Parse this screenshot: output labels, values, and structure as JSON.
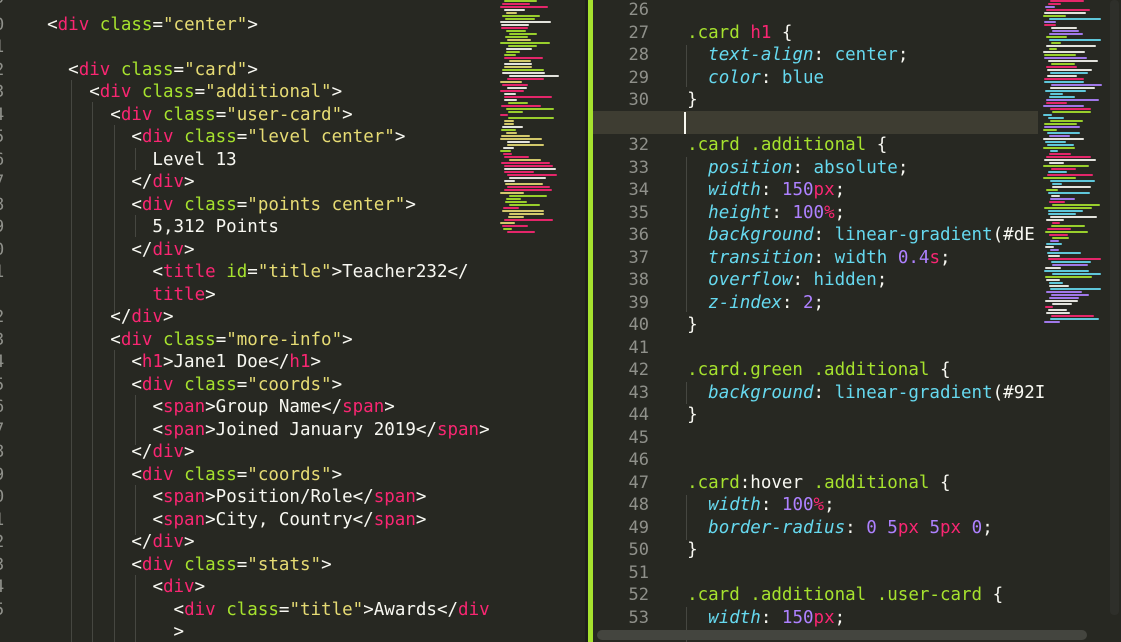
{
  "left_editor": {
    "line_numbers": [
      "0",
      "0",
      "1",
      "2",
      "3",
      "4",
      "5",
      "6",
      "7",
      "8",
      "9",
      "0",
      "1",
      "",
      "2",
      "3",
      "4",
      "5",
      "6",
      "7",
      "8",
      "9",
      "0",
      "1",
      "2",
      "3",
      "4",
      "5",
      ""
    ],
    "lines": [
      [
        [
          "p",
          "  "
        ],
        [
          "p",
          "<"
        ],
        [
          "t",
          "div"
        ],
        [
          "p",
          " "
        ],
        [
          "a",
          "class"
        ],
        [
          "p",
          "="
        ],
        [
          "s",
          "\"center\""
        ],
        [
          "p",
          ">"
        ]
      ],
      [],
      [
        [
          "p",
          "    "
        ],
        [
          "p",
          "<"
        ],
        [
          "t",
          "div"
        ],
        [
          "p",
          " "
        ],
        [
          "a",
          "class"
        ],
        [
          "p",
          "="
        ],
        [
          "s",
          "\"card\""
        ],
        [
          "p",
          ">"
        ]
      ],
      [
        [
          "p",
          "      "
        ],
        [
          "p",
          "<"
        ],
        [
          "t",
          "div"
        ],
        [
          "p",
          " "
        ],
        [
          "a",
          "class"
        ],
        [
          "p",
          "="
        ],
        [
          "s",
          "\"additional\""
        ],
        [
          "p",
          ">"
        ]
      ],
      [
        [
          "p",
          "        "
        ],
        [
          "p",
          "<"
        ],
        [
          "t",
          "div"
        ],
        [
          "p",
          " "
        ],
        [
          "a",
          "class"
        ],
        [
          "p",
          "="
        ],
        [
          "s",
          "\"user-card\""
        ],
        [
          "p",
          ">"
        ]
      ],
      [
        [
          "p",
          "          "
        ],
        [
          "p",
          "<"
        ],
        [
          "t",
          "div"
        ],
        [
          "p",
          " "
        ],
        [
          "a",
          "class"
        ],
        [
          "p",
          "="
        ],
        [
          "s",
          "\"level center\""
        ],
        [
          "p",
          ">"
        ]
      ],
      [
        [
          "p",
          "            Level 13"
        ]
      ],
      [
        [
          "p",
          "          "
        ],
        [
          "p",
          "</"
        ],
        [
          "t",
          "div"
        ],
        [
          "p",
          ">"
        ]
      ],
      [
        [
          "p",
          "          "
        ],
        [
          "p",
          "<"
        ],
        [
          "t",
          "div"
        ],
        [
          "p",
          " "
        ],
        [
          "a",
          "class"
        ],
        [
          "p",
          "="
        ],
        [
          "s",
          "\"points center\""
        ],
        [
          "p",
          ">"
        ]
      ],
      [
        [
          "p",
          "            5,312 Points"
        ]
      ],
      [
        [
          "p",
          "          "
        ],
        [
          "p",
          "</"
        ],
        [
          "t",
          "div"
        ],
        [
          "p",
          ">"
        ]
      ],
      [
        [
          "p",
          "            "
        ],
        [
          "p",
          "<"
        ],
        [
          "t",
          "title"
        ],
        [
          "p",
          " "
        ],
        [
          "a",
          "id"
        ],
        [
          "p",
          "="
        ],
        [
          "s",
          "\"title\""
        ],
        [
          "p",
          ">Teacher232</"
        ]
      ],
      [
        [
          "p",
          "            "
        ],
        [
          "t",
          "title"
        ],
        [
          "p",
          ">"
        ]
      ],
      [
        [
          "p",
          "        "
        ],
        [
          "p",
          "</"
        ],
        [
          "t",
          "div"
        ],
        [
          "p",
          ">"
        ]
      ],
      [
        [
          "p",
          "        "
        ],
        [
          "p",
          "<"
        ],
        [
          "t",
          "div"
        ],
        [
          "p",
          " "
        ],
        [
          "a",
          "class"
        ],
        [
          "p",
          "="
        ],
        [
          "s",
          "\"more-info\""
        ],
        [
          "p",
          ">"
        ]
      ],
      [
        [
          "p",
          "          "
        ],
        [
          "p",
          "<"
        ],
        [
          "t",
          "h1"
        ],
        [
          "p",
          ">Jane1 Doe</"
        ],
        [
          "t",
          "h1"
        ],
        [
          "p",
          ">"
        ]
      ],
      [
        [
          "p",
          "          "
        ],
        [
          "p",
          "<"
        ],
        [
          "t",
          "div"
        ],
        [
          "p",
          " "
        ],
        [
          "a",
          "class"
        ],
        [
          "p",
          "="
        ],
        [
          "s",
          "\"coords\""
        ],
        [
          "p",
          ">"
        ]
      ],
      [
        [
          "p",
          "            "
        ],
        [
          "p",
          "<"
        ],
        [
          "t",
          "span"
        ],
        [
          "p",
          ">Group Name</"
        ],
        [
          "t",
          "span"
        ],
        [
          "p",
          ">"
        ]
      ],
      [
        [
          "p",
          "            "
        ],
        [
          "p",
          "<"
        ],
        [
          "t",
          "span"
        ],
        [
          "p",
          ">Joined January 2019</"
        ],
        [
          "t",
          "span"
        ],
        [
          "p",
          ">"
        ]
      ],
      [
        [
          "p",
          "          "
        ],
        [
          "p",
          "</"
        ],
        [
          "t",
          "div"
        ],
        [
          "p",
          ">"
        ]
      ],
      [
        [
          "p",
          "          "
        ],
        [
          "p",
          "<"
        ],
        [
          "t",
          "div"
        ],
        [
          "p",
          " "
        ],
        [
          "a",
          "class"
        ],
        [
          "p",
          "="
        ],
        [
          "s",
          "\"coords\""
        ],
        [
          "p",
          ">"
        ]
      ],
      [
        [
          "p",
          "            "
        ],
        [
          "p",
          "<"
        ],
        [
          "t",
          "span"
        ],
        [
          "p",
          ">Position/Role</"
        ],
        [
          "t",
          "span"
        ],
        [
          "p",
          ">"
        ]
      ],
      [
        [
          "p",
          "            "
        ],
        [
          "p",
          "<"
        ],
        [
          "t",
          "span"
        ],
        [
          "p",
          ">City, Country</"
        ],
        [
          "t",
          "span"
        ],
        [
          "p",
          ">"
        ]
      ],
      [
        [
          "p",
          "          "
        ],
        [
          "p",
          "</"
        ],
        [
          "t",
          "div"
        ],
        [
          "p",
          ">"
        ]
      ],
      [
        [
          "p",
          "          "
        ],
        [
          "p",
          "<"
        ],
        [
          "t",
          "div"
        ],
        [
          "p",
          " "
        ],
        [
          "a",
          "class"
        ],
        [
          "p",
          "="
        ],
        [
          "s",
          "\"stats\""
        ],
        [
          "p",
          ">"
        ]
      ],
      [
        [
          "p",
          "            "
        ],
        [
          "p",
          "<"
        ],
        [
          "t",
          "div"
        ],
        [
          "p",
          ">"
        ]
      ],
      [
        [
          "p",
          "              "
        ],
        [
          "p",
          "<"
        ],
        [
          "t",
          "div"
        ],
        [
          "p",
          " "
        ],
        [
          "a",
          "class"
        ],
        [
          "p",
          "="
        ],
        [
          "s",
          "\"title\""
        ],
        [
          "p",
          ">Awards</"
        ],
        [
          "t",
          "div"
        ]
      ],
      [
        [
          "p",
          "              >"
        ]
      ]
    ]
  },
  "right_editor": {
    "line_numbers": [
      "26",
      "27",
      "28",
      "29",
      "30",
      "31",
      "32",
      "33",
      "34",
      "35",
      "36",
      "37",
      "38",
      "39",
      "40",
      "41",
      "42",
      "43",
      "44",
      "45",
      "46",
      "47",
      "48",
      "49",
      "50",
      "51",
      "52",
      "53"
    ],
    "current_line": "31",
    "lines": [
      [],
      [
        [
          "p",
          "  "
        ],
        [
          "sel",
          ".card"
        ],
        [
          "p",
          " "
        ],
        [
          "t",
          "h1"
        ],
        [
          "p",
          " {"
        ]
      ],
      [
        [
          "p",
          "    "
        ],
        [
          "prop",
          "text-align"
        ],
        [
          "p",
          ": "
        ],
        [
          "kw",
          "center"
        ],
        [
          "p",
          ";"
        ]
      ],
      [
        [
          "p",
          "    "
        ],
        [
          "prop",
          "color"
        ],
        [
          "p",
          ": "
        ],
        [
          "kw",
          "blue"
        ]
      ],
      [
        [
          "p",
          "  }"
        ]
      ],
      [],
      [
        [
          "p",
          "  "
        ],
        [
          "sel",
          ".card .additional"
        ],
        [
          "p",
          " {"
        ]
      ],
      [
        [
          "p",
          "    "
        ],
        [
          "prop",
          "position"
        ],
        [
          "p",
          ": "
        ],
        [
          "kw",
          "absolute"
        ],
        [
          "p",
          ";"
        ]
      ],
      [
        [
          "p",
          "    "
        ],
        [
          "prop",
          "width"
        ],
        [
          "p",
          ": "
        ],
        [
          "num",
          "150"
        ],
        [
          "unit",
          "px"
        ],
        [
          "p",
          ";"
        ]
      ],
      [
        [
          "p",
          "    "
        ],
        [
          "prop",
          "height"
        ],
        [
          "p",
          ": "
        ],
        [
          "num",
          "100"
        ],
        [
          "unit",
          "%"
        ],
        [
          "p",
          ";"
        ]
      ],
      [
        [
          "p",
          "    "
        ],
        [
          "prop",
          "background"
        ],
        [
          "p",
          ": "
        ],
        [
          "kw",
          "linear-gradient"
        ],
        [
          "p",
          "(#dE"
        ]
      ],
      [
        [
          "p",
          "    "
        ],
        [
          "prop",
          "transition"
        ],
        [
          "p",
          ": "
        ],
        [
          "kw",
          "width"
        ],
        [
          "p",
          " "
        ],
        [
          "num",
          "0.4"
        ],
        [
          "unit",
          "s"
        ],
        [
          "p",
          ";"
        ]
      ],
      [
        [
          "p",
          "    "
        ],
        [
          "prop",
          "overflow"
        ],
        [
          "p",
          ": "
        ],
        [
          "kw",
          "hidden"
        ],
        [
          "p",
          ";"
        ]
      ],
      [
        [
          "p",
          "    "
        ],
        [
          "prop",
          "z-index"
        ],
        [
          "p",
          ": "
        ],
        [
          "num",
          "2"
        ],
        [
          "p",
          ";"
        ]
      ],
      [
        [
          "p",
          "  }"
        ]
      ],
      [],
      [
        [
          "p",
          "  "
        ],
        [
          "sel",
          ".card.green .additional"
        ],
        [
          "p",
          " {"
        ]
      ],
      [
        [
          "p",
          "    "
        ],
        [
          "prop",
          "background"
        ],
        [
          "p",
          ": "
        ],
        [
          "kw",
          "linear-gradient"
        ],
        [
          "p",
          "(#92I"
        ]
      ],
      [
        [
          "p",
          "  }"
        ]
      ],
      [],
      [],
      [
        [
          "p",
          "  "
        ],
        [
          "sel",
          ".card"
        ],
        [
          "p",
          ":hover "
        ],
        [
          "sel",
          ".additional"
        ],
        [
          "p",
          " {"
        ]
      ],
      [
        [
          "p",
          "    "
        ],
        [
          "prop",
          "width"
        ],
        [
          "p",
          ": "
        ],
        [
          "num",
          "100"
        ],
        [
          "unit",
          "%"
        ],
        [
          "p",
          ";"
        ]
      ],
      [
        [
          "p",
          "    "
        ],
        [
          "prop",
          "border-radius"
        ],
        [
          "p",
          ": "
        ],
        [
          "num",
          "0"
        ],
        [
          "p",
          " "
        ],
        [
          "num",
          "5"
        ],
        [
          "unit",
          "px"
        ],
        [
          "p",
          " "
        ],
        [
          "num",
          "5"
        ],
        [
          "unit",
          "px"
        ],
        [
          "p",
          " "
        ],
        [
          "num",
          "0"
        ],
        [
          "p",
          ";"
        ]
      ],
      [
        [
          "p",
          "  }"
        ]
      ],
      [],
      [
        [
          "p",
          "  "
        ],
        [
          "sel",
          ".card .additional .user-card"
        ],
        [
          "p",
          " {"
        ]
      ],
      [
        [
          "p",
          "    "
        ],
        [
          "prop",
          "width"
        ],
        [
          "p",
          ": "
        ],
        [
          "num",
          "150"
        ],
        [
          "unit",
          "px"
        ],
        [
          "p",
          ";"
        ]
      ]
    ]
  },
  "theme": {
    "background": "#272822",
    "tag": "#f92672",
    "attribute": "#a6e22e",
    "string": "#e6db74",
    "property": "#66d9ef",
    "number": "#ae81ff",
    "text": "#f8f8f2",
    "modified_marker": "#a6e22e"
  }
}
